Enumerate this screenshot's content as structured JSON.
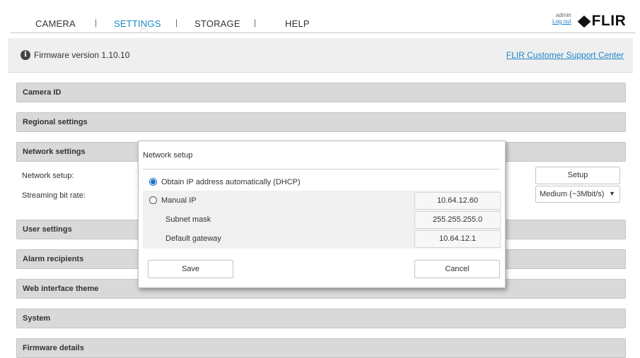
{
  "nav": {
    "items": [
      {
        "label": "CAMERA",
        "active": false
      },
      {
        "label": "SETTINGS",
        "active": true
      },
      {
        "label": "STORAGE",
        "active": false
      },
      {
        "label": "HELP",
        "active": false
      }
    ],
    "separator": "|",
    "user": "admin",
    "logout_label": "Log out",
    "logo_text": "FLIR",
    "accent_color": "#1c86c9"
  },
  "firmware_bar": {
    "icon": "info-icon",
    "version_text": "Firmware version 1.10.10",
    "support_link": "FLIR Customer Support Center"
  },
  "sections": [
    {
      "title": "Camera ID"
    },
    {
      "title": "Regional settings"
    },
    {
      "title": "Network settings"
    },
    {
      "title": "User settings"
    },
    {
      "title": "Alarm recipients"
    },
    {
      "title": "Web interface theme"
    },
    {
      "title": "System"
    },
    {
      "title": "Firmware details"
    }
  ],
  "network_settings": {
    "network_setup_label": "Network setup:",
    "streaming_label": "Streaming bit rate:",
    "setup_button": "Setup",
    "bitrate_selected": "Medium (~3Mbit/s)",
    "dropdown_arrow": "▼"
  },
  "modal": {
    "title": "Network setup",
    "dhcp_label": "Obtain IP address automatically (DHCP)",
    "dhcp_selected": true,
    "manual_label": "Manual IP",
    "manual_ip": "10.64.12.60",
    "subnet_label": "Subnet mask",
    "subnet_value": "255.255.255.0",
    "gateway_label": "Default gateway",
    "gateway_value": "10.64.12.1",
    "save_label": "Save",
    "cancel_label": "Cancel"
  }
}
